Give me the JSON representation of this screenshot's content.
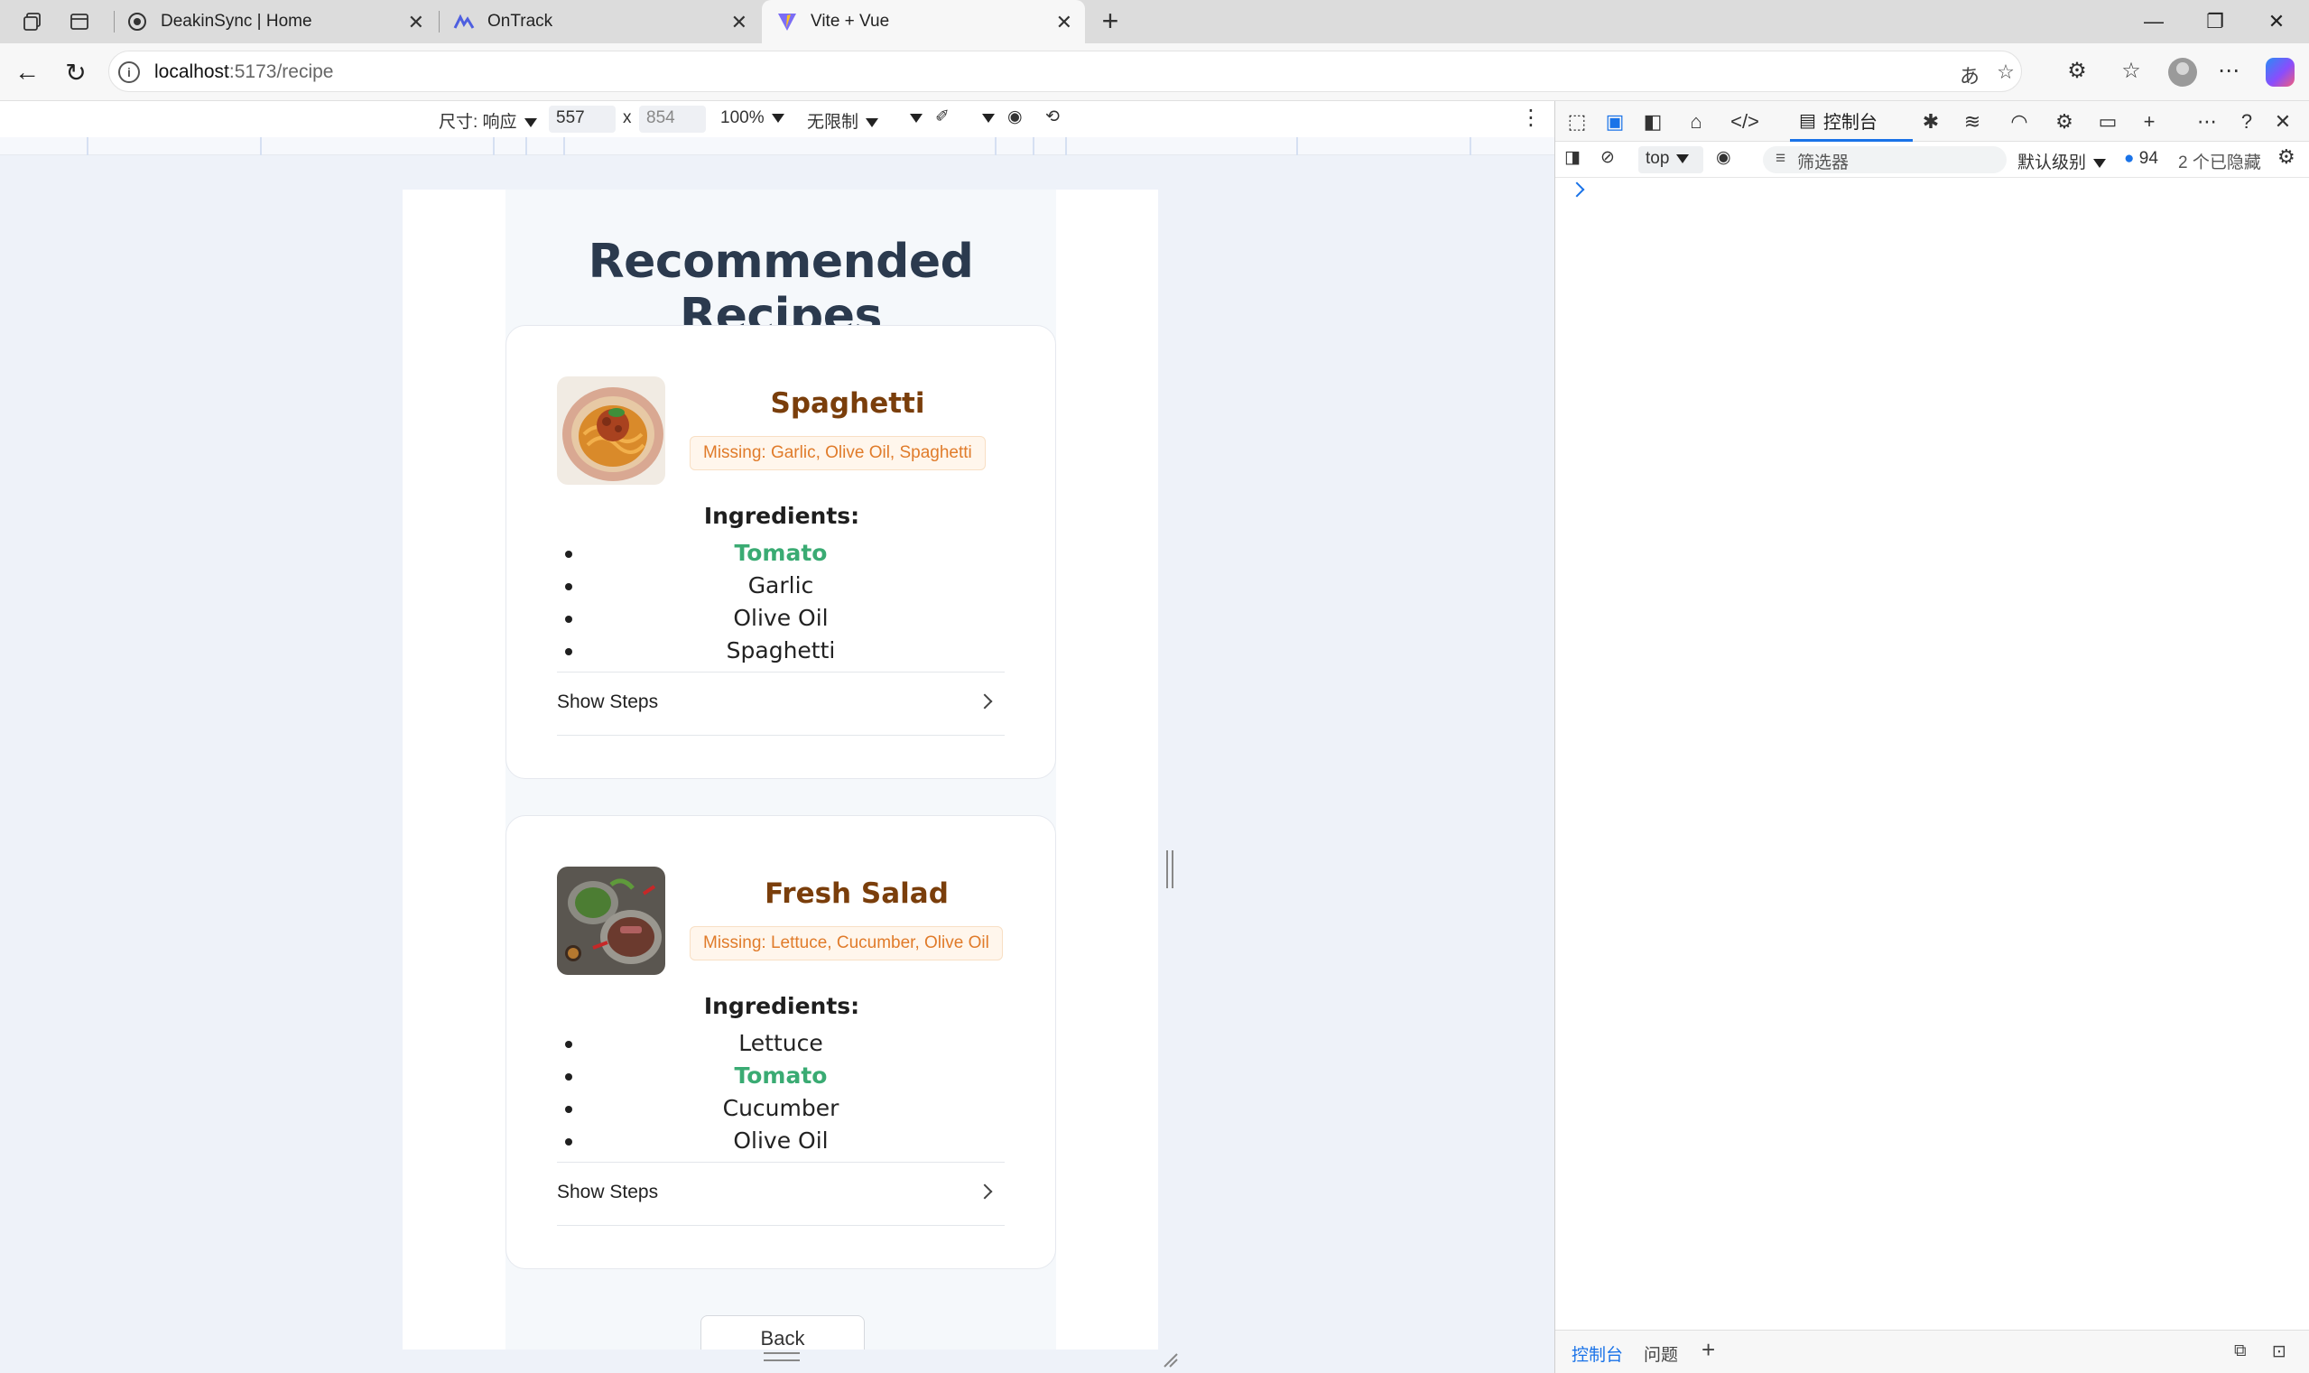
{
  "browser": {
    "tabs": [
      {
        "label": "DeakinSync | Home"
      },
      {
        "label": "OnTrack"
      },
      {
        "label": "Vite + Vue"
      }
    ],
    "url_host": "localhost",
    "url_path": ":5173/recipe"
  },
  "device_toolbar": {
    "dimensions_label": "尺寸: 响应",
    "width": "557",
    "times": "x",
    "height": "854",
    "zoom": "100%",
    "throttle": "无限制"
  },
  "page": {
    "title": "Recommended Recipes",
    "ingredients_heading": "Ingredients:",
    "show_steps_label": "Show Steps",
    "back_label": "Back",
    "recipes": [
      {
        "name": "Spaghetti",
        "missing": "Missing: Garlic, Olive Oil, Spaghetti",
        "ingredients": [
          {
            "name": "Tomato",
            "have": true
          },
          {
            "name": "Garlic",
            "have": false
          },
          {
            "name": "Olive Oil",
            "have": false
          },
          {
            "name": "Spaghetti",
            "have": false
          }
        ]
      },
      {
        "name": "Fresh Salad",
        "missing": "Missing: Lettuce, Cucumber, Olive Oil",
        "ingredients": [
          {
            "name": "Lettuce",
            "have": false
          },
          {
            "name": "Tomato",
            "have": true
          },
          {
            "name": "Cucumber",
            "have": false
          },
          {
            "name": "Olive Oil",
            "have": false
          }
        ]
      }
    ]
  },
  "devtools": {
    "active_tab": "控制台",
    "context": "top",
    "filter_placeholder": "筛选器",
    "level": "默认级别",
    "issue_count": "94",
    "hidden_count": "2 个已隐藏",
    "drawer_tabs": [
      "控制台",
      "问题"
    ]
  },
  "colors": {
    "title": "#2b3a4e",
    "recipe_name": "#7a3e0b",
    "missing_text": "#e07b2a",
    "have_ingredient": "#3aab73",
    "accent": "#1a73e8"
  }
}
